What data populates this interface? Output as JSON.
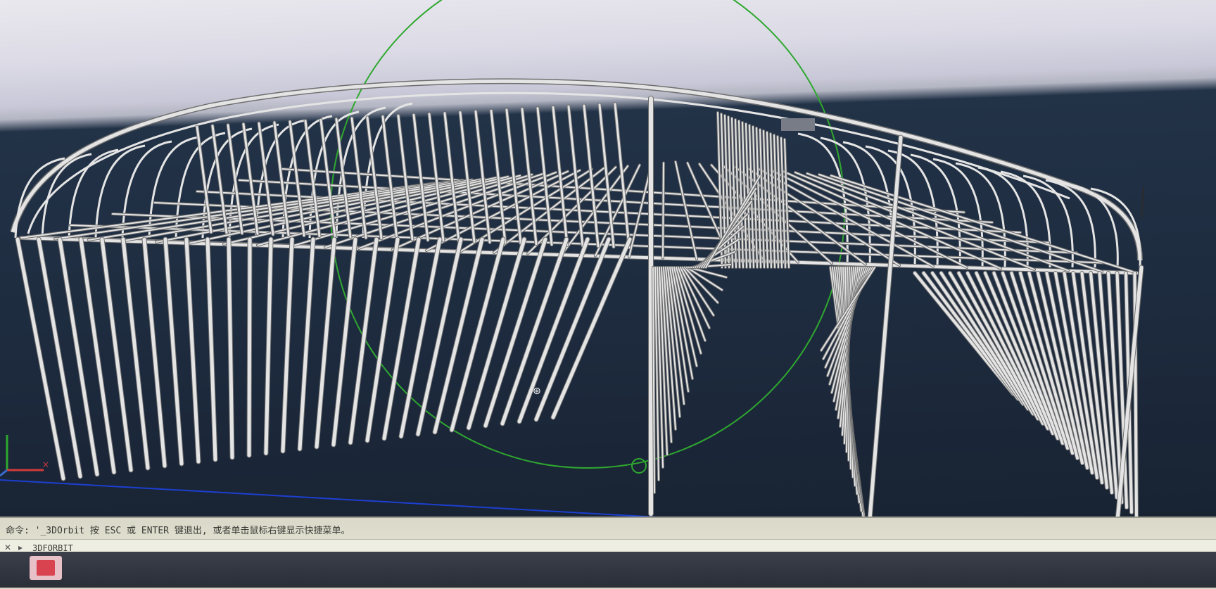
{
  "viewport": {
    "background_top": "#e9e8ee",
    "background_bottom": "#1d2a3d",
    "structure_color": "#e4e4e4",
    "orbit_circle_color": "#2fa82f",
    "ground_line_color": "#1d3fd0"
  },
  "command_line": {
    "history": "命令: '_3DOrbit 按 ESC 或 ENTER 键退出, 或者单击鼠标右键显示快捷菜单。",
    "input_value": "3DFORBIT",
    "close_icon": "close-icon",
    "prompt_icon": "command-prompt-icon"
  },
  "taskbar": {
    "app_icon": "autocad-app-icon"
  }
}
